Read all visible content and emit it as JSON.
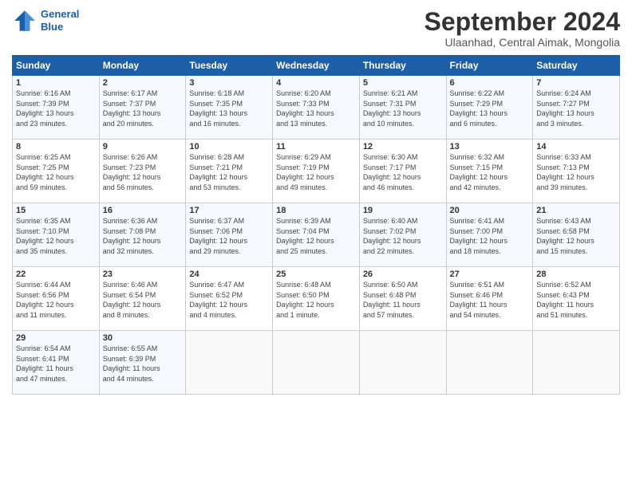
{
  "header": {
    "logo_line1": "General",
    "logo_line2": "Blue",
    "title": "September 2024",
    "subtitle": "Ulaanhad, Central Aimak, Mongolia"
  },
  "weekdays": [
    "Sunday",
    "Monday",
    "Tuesday",
    "Wednesday",
    "Thursday",
    "Friday",
    "Saturday"
  ],
  "weeks": [
    [
      {
        "day": "1",
        "info": "Sunrise: 6:16 AM\nSunset: 7:39 PM\nDaylight: 13 hours\nand 23 minutes."
      },
      {
        "day": "2",
        "info": "Sunrise: 6:17 AM\nSunset: 7:37 PM\nDaylight: 13 hours\nand 20 minutes."
      },
      {
        "day": "3",
        "info": "Sunrise: 6:18 AM\nSunset: 7:35 PM\nDaylight: 13 hours\nand 16 minutes."
      },
      {
        "day": "4",
        "info": "Sunrise: 6:20 AM\nSunset: 7:33 PM\nDaylight: 13 hours\nand 13 minutes."
      },
      {
        "day": "5",
        "info": "Sunrise: 6:21 AM\nSunset: 7:31 PM\nDaylight: 13 hours\nand 10 minutes."
      },
      {
        "day": "6",
        "info": "Sunrise: 6:22 AM\nSunset: 7:29 PM\nDaylight: 13 hours\nand 6 minutes."
      },
      {
        "day": "7",
        "info": "Sunrise: 6:24 AM\nSunset: 7:27 PM\nDaylight: 13 hours\nand 3 minutes."
      }
    ],
    [
      {
        "day": "8",
        "info": "Sunrise: 6:25 AM\nSunset: 7:25 PM\nDaylight: 12 hours\nand 59 minutes."
      },
      {
        "day": "9",
        "info": "Sunrise: 6:26 AM\nSunset: 7:23 PM\nDaylight: 12 hours\nand 56 minutes."
      },
      {
        "day": "10",
        "info": "Sunrise: 6:28 AM\nSunset: 7:21 PM\nDaylight: 12 hours\nand 53 minutes."
      },
      {
        "day": "11",
        "info": "Sunrise: 6:29 AM\nSunset: 7:19 PM\nDaylight: 12 hours\nand 49 minutes."
      },
      {
        "day": "12",
        "info": "Sunrise: 6:30 AM\nSunset: 7:17 PM\nDaylight: 12 hours\nand 46 minutes."
      },
      {
        "day": "13",
        "info": "Sunrise: 6:32 AM\nSunset: 7:15 PM\nDaylight: 12 hours\nand 42 minutes."
      },
      {
        "day": "14",
        "info": "Sunrise: 6:33 AM\nSunset: 7:13 PM\nDaylight: 12 hours\nand 39 minutes."
      }
    ],
    [
      {
        "day": "15",
        "info": "Sunrise: 6:35 AM\nSunset: 7:10 PM\nDaylight: 12 hours\nand 35 minutes."
      },
      {
        "day": "16",
        "info": "Sunrise: 6:36 AM\nSunset: 7:08 PM\nDaylight: 12 hours\nand 32 minutes."
      },
      {
        "day": "17",
        "info": "Sunrise: 6:37 AM\nSunset: 7:06 PM\nDaylight: 12 hours\nand 29 minutes."
      },
      {
        "day": "18",
        "info": "Sunrise: 6:39 AM\nSunset: 7:04 PM\nDaylight: 12 hours\nand 25 minutes."
      },
      {
        "day": "19",
        "info": "Sunrise: 6:40 AM\nSunset: 7:02 PM\nDaylight: 12 hours\nand 22 minutes."
      },
      {
        "day": "20",
        "info": "Sunrise: 6:41 AM\nSunset: 7:00 PM\nDaylight: 12 hours\nand 18 minutes."
      },
      {
        "day": "21",
        "info": "Sunrise: 6:43 AM\nSunset: 6:58 PM\nDaylight: 12 hours\nand 15 minutes."
      }
    ],
    [
      {
        "day": "22",
        "info": "Sunrise: 6:44 AM\nSunset: 6:56 PM\nDaylight: 12 hours\nand 11 minutes."
      },
      {
        "day": "23",
        "info": "Sunrise: 6:46 AM\nSunset: 6:54 PM\nDaylight: 12 hours\nand 8 minutes."
      },
      {
        "day": "24",
        "info": "Sunrise: 6:47 AM\nSunset: 6:52 PM\nDaylight: 12 hours\nand 4 minutes."
      },
      {
        "day": "25",
        "info": "Sunrise: 6:48 AM\nSunset: 6:50 PM\nDaylight: 12 hours\nand 1 minute."
      },
      {
        "day": "26",
        "info": "Sunrise: 6:50 AM\nSunset: 6:48 PM\nDaylight: 11 hours\nand 57 minutes."
      },
      {
        "day": "27",
        "info": "Sunrise: 6:51 AM\nSunset: 6:46 PM\nDaylight: 11 hours\nand 54 minutes."
      },
      {
        "day": "28",
        "info": "Sunrise: 6:52 AM\nSunset: 6:43 PM\nDaylight: 11 hours\nand 51 minutes."
      }
    ],
    [
      {
        "day": "29",
        "info": "Sunrise: 6:54 AM\nSunset: 6:41 PM\nDaylight: 11 hours\nand 47 minutes."
      },
      {
        "day": "30",
        "info": "Sunrise: 6:55 AM\nSunset: 6:39 PM\nDaylight: 11 hours\nand 44 minutes."
      },
      {
        "day": "",
        "info": ""
      },
      {
        "day": "",
        "info": ""
      },
      {
        "day": "",
        "info": ""
      },
      {
        "day": "",
        "info": ""
      },
      {
        "day": "",
        "info": ""
      }
    ]
  ]
}
